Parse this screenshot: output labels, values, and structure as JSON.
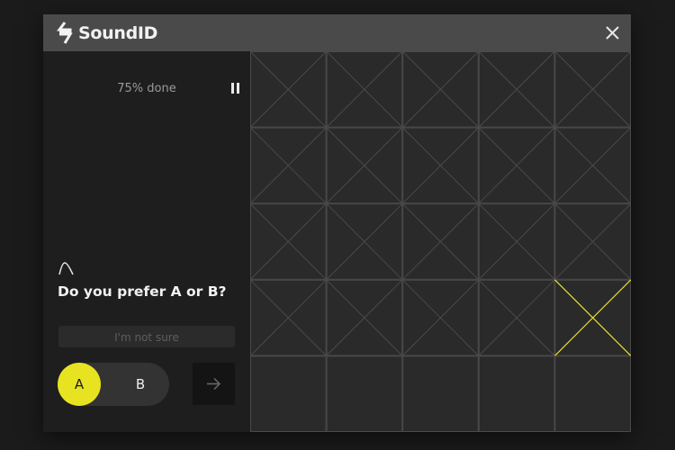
{
  "app": {
    "brand": "SoundID",
    "logo_icon": "soundid-logo-icon",
    "close_icon": "close-icon"
  },
  "progress": {
    "text": "75% done",
    "percent": 75,
    "pause_icon": "pause-icon"
  },
  "question": {
    "icon": "curve-icon",
    "text": "Do you prefer A or B?",
    "not_sure_label": "I'm not sure"
  },
  "choices": {
    "a_label": "A",
    "b_label": "B",
    "selected": "A",
    "next_icon": "arrow-right-icon"
  },
  "grid": {
    "rows": 5,
    "cols": 5,
    "rows_with_marks": 4,
    "active_cell": {
      "row": 4,
      "col": 5
    }
  },
  "colors": {
    "accent": "#e8e320",
    "titlebar": "#4a4a4a",
    "panel": "#1e1e1e",
    "grid_bg": "#2a2a2a",
    "grid_line": "#4a4a4a"
  }
}
